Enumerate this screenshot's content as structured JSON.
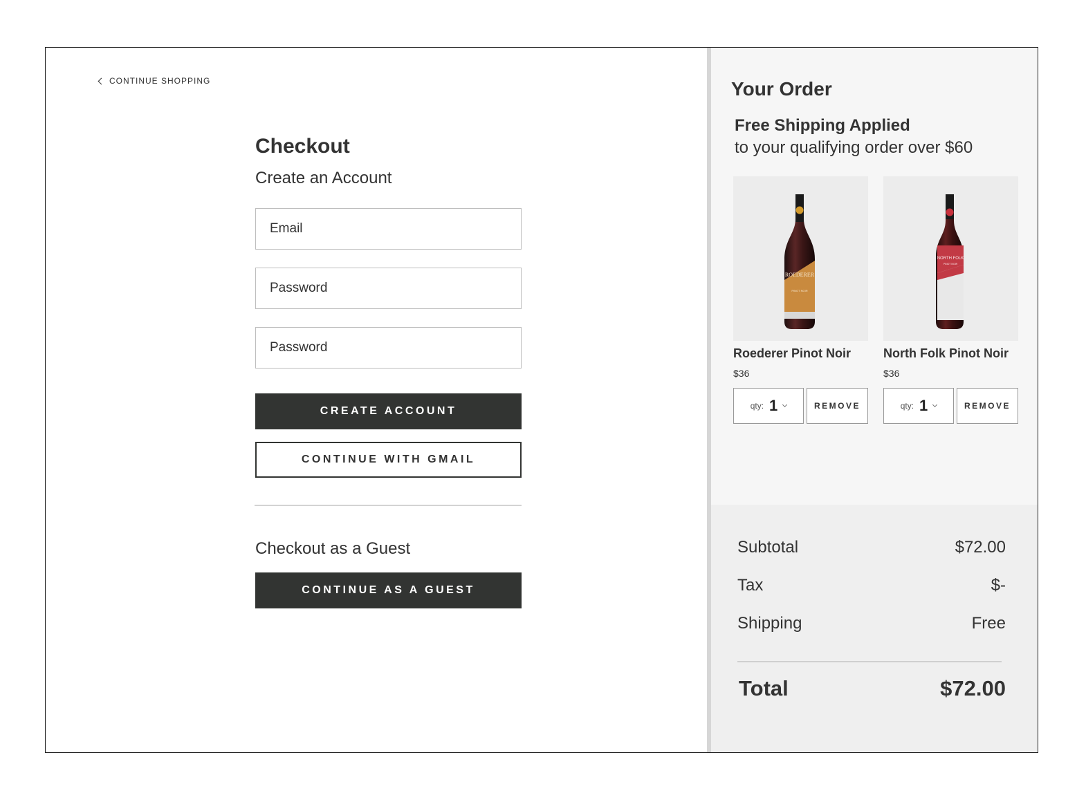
{
  "nav": {
    "back_label": "CONTINUE SHOPPING"
  },
  "checkout": {
    "title": "Checkout",
    "create_account_heading": "Create an Account",
    "email_placeholder": "Email",
    "password_placeholder": "Password",
    "confirm_password_placeholder": "Password",
    "create_account_button": "CREATE ACCOUNT",
    "gmail_button": "CONTINUE WITH GMAIL",
    "guest_heading": "Checkout as a Guest",
    "guest_button": "CONTINUE AS A GUEST"
  },
  "order": {
    "title": "Your Order",
    "shipping_title": "Free Shipping Applied",
    "shipping_subtitle": "to your qualifying order over $60",
    "items": [
      {
        "name": "Roederer Pinot Noir",
        "price": "$36",
        "qty_label": "qty:",
        "qty": "1",
        "remove_label": "REMOVE",
        "label_color": "#c98a3e",
        "label_text": "ROEDERER",
        "label_subtext": "PINOT NOIR",
        "capsule_color": "#d39a2c"
      },
      {
        "name": "North Folk Pinot Noir",
        "price": "$36",
        "qty_label": "qty:",
        "qty": "1",
        "remove_label": "REMOVE",
        "label_color": "#c23a45",
        "label_text": "NORTH FOLK",
        "label_subtext": "PINOT NOIR",
        "capsule_color": "#c8313d"
      }
    ]
  },
  "summary": {
    "subtotal_label": "Subtotal",
    "subtotal_value": "$72.00",
    "tax_label": "Tax",
    "tax_value": "$-",
    "shipping_label": "Shipping",
    "shipping_value": "Free",
    "total_label": "Total",
    "total_value": "$72.00"
  }
}
